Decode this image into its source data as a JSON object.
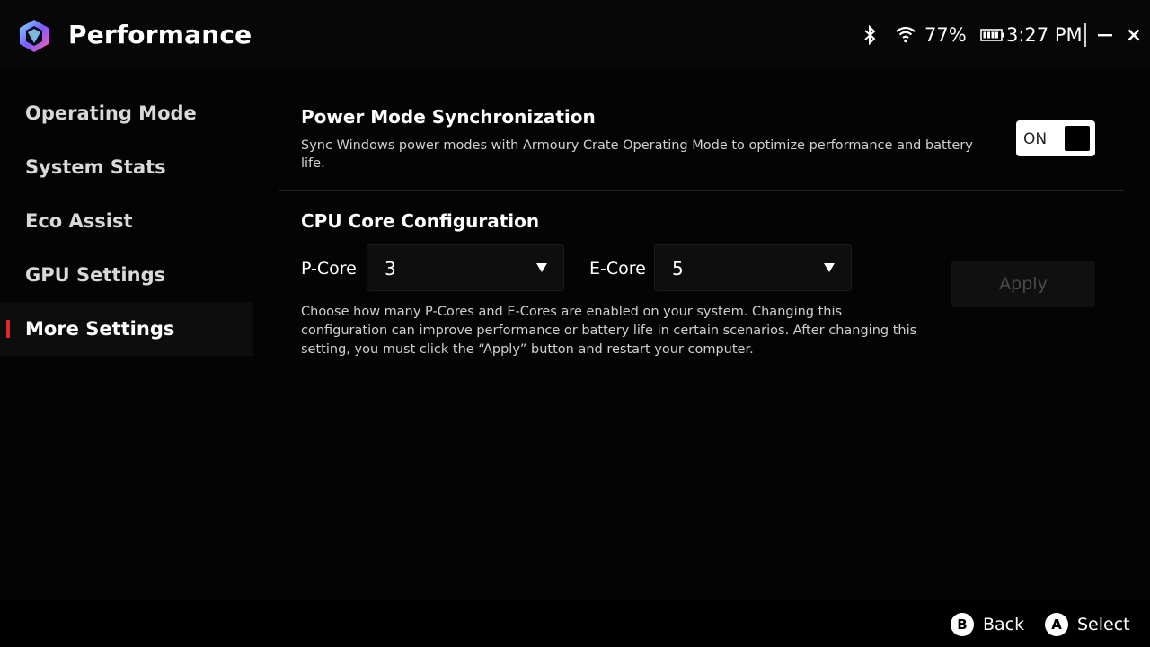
{
  "header": {
    "title": "Performance",
    "status": {
      "battery_percent": "77%",
      "clock": "3:27 PM"
    }
  },
  "sidebar": {
    "items": [
      {
        "label": "Operating Mode",
        "active": false
      },
      {
        "label": "System Stats",
        "active": false
      },
      {
        "label": "Eco Assist",
        "active": false
      },
      {
        "label": "GPU Settings",
        "active": false
      },
      {
        "label": "More Settings",
        "active": true
      }
    ]
  },
  "power_sync": {
    "title": "Power Mode Synchronization",
    "description": "Sync Windows power modes with Armoury Crate Operating Mode to optimize performance and battery life.",
    "toggle_label": "ON"
  },
  "cpu_config": {
    "title": "CPU Core Configuration",
    "p_core_label": "P-Core",
    "p_core_value": "3",
    "e_core_label": "E-Core",
    "e_core_value": "5",
    "apply_label": "Apply",
    "description": "Choose how many P-Cores and E-Cores are enabled on your system. Changing this configuration can improve performance or battery life in certain scenarios. After changing this setting, you must click the “Apply” button and restart your computer."
  },
  "footer": {
    "back_key": "B",
    "back_label": "Back",
    "select_key": "A",
    "select_label": "Select"
  },
  "colors": {
    "accent": "#e0262d",
    "background": "#040404"
  }
}
